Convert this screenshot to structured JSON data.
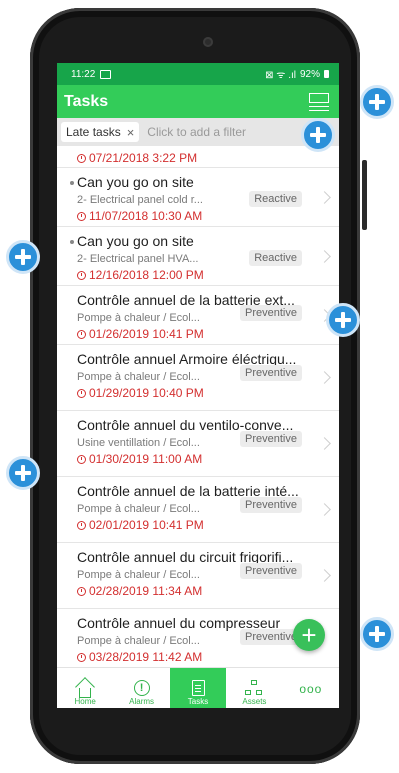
{
  "status_bar": {
    "time": "11:22",
    "signal": "⊠ ᯤ .ıl",
    "battery": "92%"
  },
  "app_bar": {
    "title": "Tasks"
  },
  "filter_bar": {
    "chip_label": "Late tasks",
    "chip_close": "×",
    "placeholder": "Click to add a filter"
  },
  "tasks": [
    {
      "title": "",
      "subtitle": "",
      "date": "07/21/2018 3:22 PM",
      "badge": ""
    },
    {
      "title": "Can you go on site",
      "subtitle": "2- Electrical panel cold r...",
      "date": "11/07/2018 10:30 AM",
      "badge": "Reactive"
    },
    {
      "title": "Can you go on site",
      "subtitle": "2- Electrical panel HVA...",
      "date": "12/16/2018 12:00 PM",
      "badge": "Reactive"
    },
    {
      "title": "Contrôle annuel de la batterie ext...",
      "subtitle": "Pompe à chaleur / Ecol...",
      "date": "01/26/2019 10:41 PM",
      "badge": "Preventive"
    },
    {
      "title": "Contrôle annuel Armoire éléctriqu...",
      "subtitle": "Pompe à chaleur / Ecol...",
      "date": "01/29/2019 10:40 PM",
      "badge": "Preventive"
    },
    {
      "title": "Contrôle annuel du ventilo-conve...",
      "subtitle": "Usine ventillation / Ecol...",
      "date": "01/30/2019 11:00 AM",
      "badge": "Preventive"
    },
    {
      "title": "Contrôle annuel de la batterie inté...",
      "subtitle": "Pompe à chaleur / Ecol...",
      "date": "02/01/2019 10:41 PM",
      "badge": "Preventive"
    },
    {
      "title": "Contrôle annuel du circuit frigorifi...",
      "subtitle": "Pompe à chaleur / Ecol...",
      "date": "02/28/2019 11:34 AM",
      "badge": "Preventive"
    },
    {
      "title": "Contrôle annuel du compresseur",
      "subtitle": "Pompe à chaleur / Ecol...",
      "date": "03/28/2019 11:42 AM",
      "badge": "Preventive"
    }
  ],
  "fab": {
    "label": "+"
  },
  "bottom_nav": {
    "home": "Home",
    "alarms": "Alarms",
    "tasks": "Tasks",
    "assets": "Assets",
    "more": "ooo"
  },
  "colors": {
    "status_bar": "#17a54a",
    "app_bar": "#33cc59",
    "date_red": "#d32f2f",
    "callout_blue": "#2b90d9"
  },
  "callouts": {
    "description": "blue-plus-icon"
  }
}
